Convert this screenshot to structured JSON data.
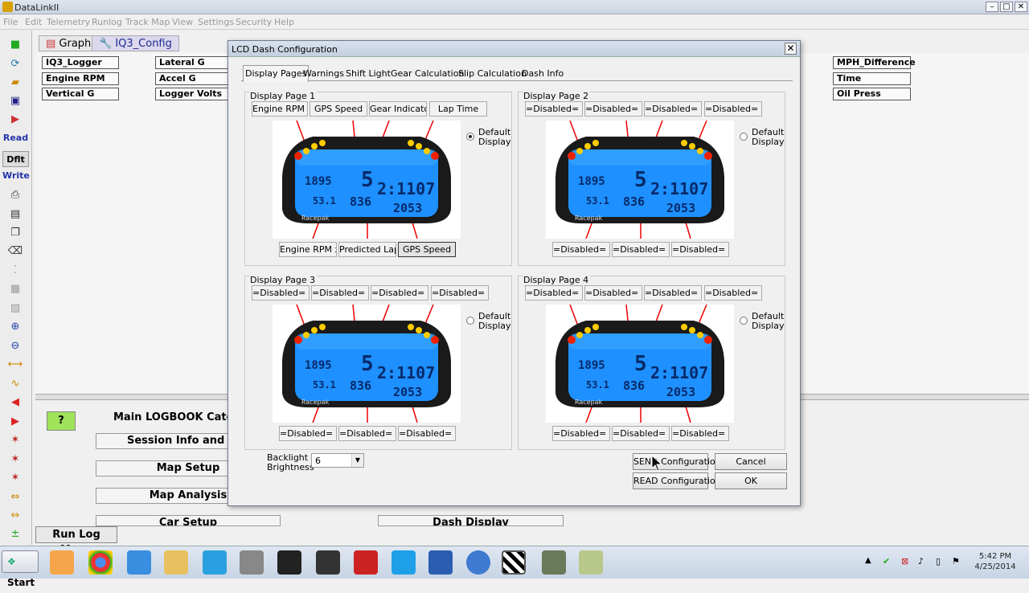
{
  "window": {
    "title": "DataLinkII"
  },
  "menu": [
    "File",
    "Edit",
    "Telemetry",
    "Runlog",
    "Track Map",
    "View",
    "Settings",
    "Security",
    "Help"
  ],
  "toolbar": {
    "read": "Read",
    "dflt": "Dflt",
    "write": "Write"
  },
  "top_tabs": [
    "Graph",
    "IQ3_Config"
  ],
  "channels": {
    "col1": [
      "IQ3_Logger",
      "Engine RPM",
      "Vertical G"
    ],
    "col2": [
      "Lateral G",
      "Accel G",
      "Logger Volts"
    ],
    "col3": [
      "MPH_Difference",
      "Time",
      "Oil Press"
    ]
  },
  "logbook": {
    "title": "Main LOGBOOK Catego",
    "buttons": [
      "Session Info and Wea",
      "Map Setup",
      "Map Analysis",
      "Car Setup"
    ],
    "dash_display": "Dash Display",
    "help_icon": "?"
  },
  "run_log_menu": "Run Log Menu",
  "dialog": {
    "title": "LCD Dash Configuration",
    "close": "✕",
    "tabs": [
      "Display Pages",
      "Warnings",
      "Shift Light",
      "Gear Calculation",
      "Slip Calculation",
      "Dash Info"
    ],
    "default_label": "Default Display",
    "pages": [
      {
        "title": "Display Page 1",
        "top": [
          "Engine RPM x",
          "GPS Speed",
          "Gear Indicator",
          "Lap Time"
        ],
        "bottom": [
          "Engine RPM x",
          "Predicted Lap",
          "GPS Speed"
        ],
        "default": true
      },
      {
        "title": "Display Page 2",
        "top": [
          "=Disabled= x0",
          "=Disabled= x0",
          "=Disabled= x0",
          "=Disabled= x0"
        ],
        "bottom": [
          "=Disabled= x0",
          "=Disabled= x0",
          "=Disabled= x0"
        ],
        "default": false
      },
      {
        "title": "Display Page 3",
        "top": [
          "=Disabled= x0",
          "=Disabled= x0",
          "=Disabled= x0",
          "=Disabled= x0"
        ],
        "bottom": [
          "=Disabled= x0",
          "=Disabled= x0",
          "=Disabled= x0"
        ],
        "default": false
      },
      {
        "title": "Display Page 4",
        "top": [
          "=Disabled= x0",
          "=Disabled= x0",
          "=Disabled= x0",
          "=Disabled= x0"
        ],
        "bottom": [
          "=Disabled= x0",
          "=Disabled= x0",
          "=Disabled= x0"
        ],
        "default": false
      }
    ],
    "dash_readout": {
      "rpm": "1895",
      "gear": "5",
      "lap": "2:1107",
      "left_small": "53.1",
      "mid_small": "836",
      "fuel": "2053",
      "brand": "Racepak"
    },
    "backlight_label": "Backlight Brightness",
    "backlight_value": "6",
    "send": "SEND Configuration",
    "read": "READ Configuration",
    "cancel": "Cancel",
    "ok": "OK"
  },
  "taskbar": {
    "start": "Start",
    "time": "5:42 PM",
    "date": "4/25/2014"
  },
  "colors": {
    "titlebar": "#c9d3e0",
    "dash_lcd": "#1e90ff",
    "dash_bezel": "#1a1a1a"
  }
}
